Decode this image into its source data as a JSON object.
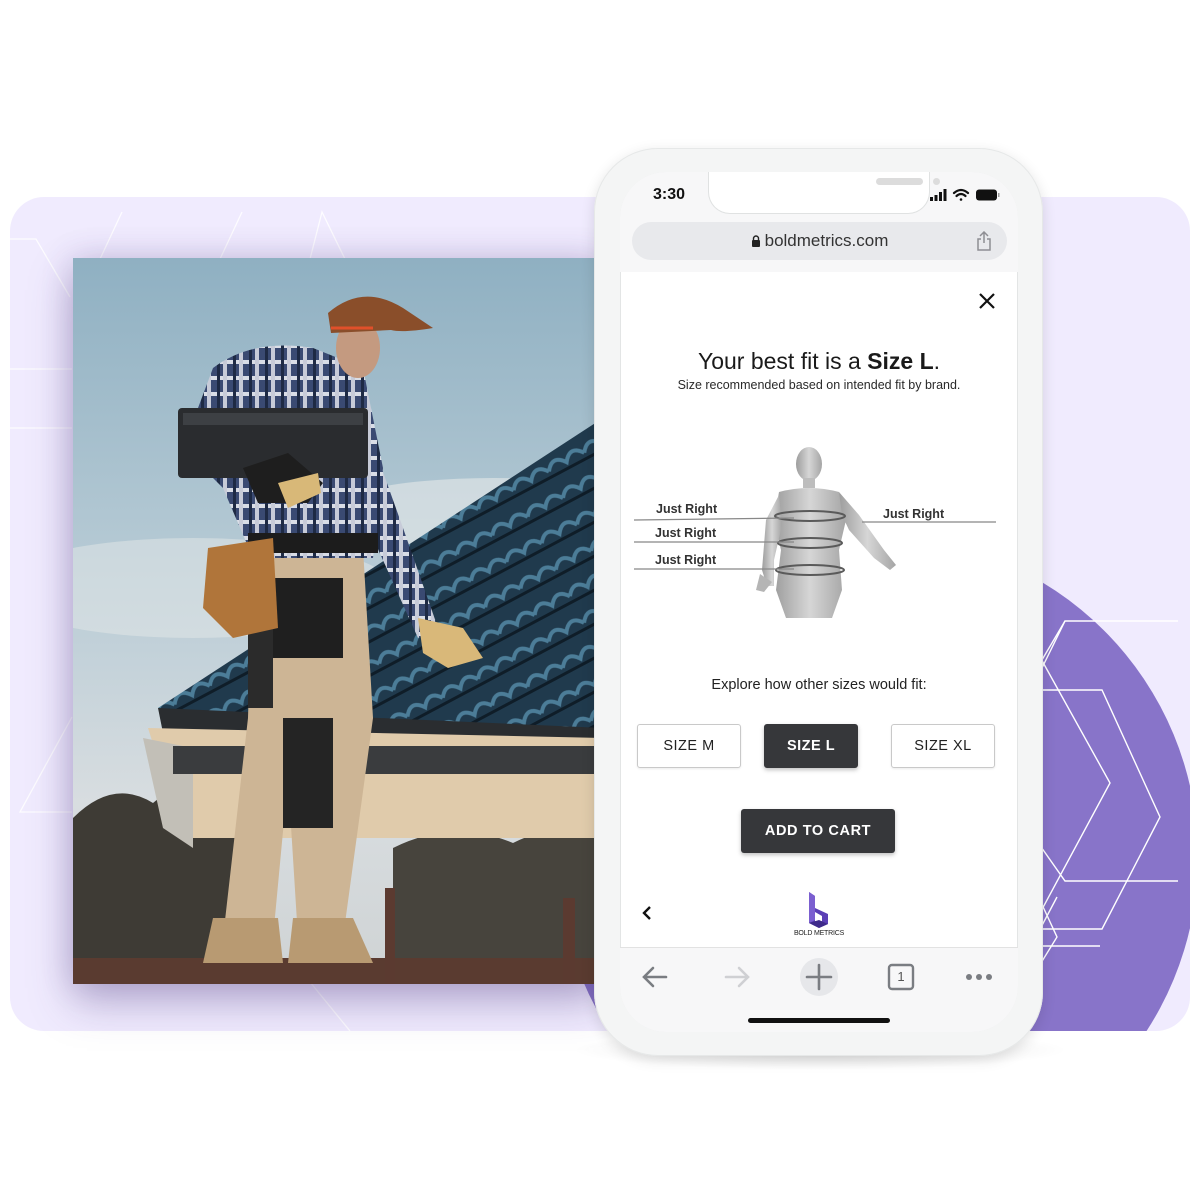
{
  "colors": {
    "panel_bg": "#f0ebfe",
    "circle": "#8874c9",
    "button_dark": "#36373a",
    "logo_purple": "#5b3fb6"
  },
  "photo": {
    "description": "Roofer in plaid shirt, cap and work overalls carrying roof tiles on a blue tiled roof"
  },
  "phone": {
    "status": {
      "time": "3:30",
      "icons": [
        "signal-icon",
        "wifi-icon",
        "battery-icon"
      ]
    },
    "url_bar": {
      "url": "boldmetrics.com",
      "icons": [
        "lock-icon",
        "share-icon"
      ]
    },
    "modal": {
      "close_icon": "close-icon",
      "headline_prefix": "Your best fit is a ",
      "headline_size": "Size L",
      "headline_suffix": ".",
      "subline": "Size recommended based on intended fit by brand.",
      "fit_labels": [
        {
          "area": "chest",
          "label": "Just Right"
        },
        {
          "area": "waist",
          "label": "Just Right"
        },
        {
          "area": "hip",
          "label": "Just Right"
        },
        {
          "area": "sleeve",
          "label": "Just Right"
        }
      ],
      "explore_text": "Explore how other sizes would fit:",
      "sizes": [
        {
          "label": "SIZE M",
          "selected": false
        },
        {
          "label": "SIZE L",
          "selected": true
        },
        {
          "label": "SIZE XL",
          "selected": false
        }
      ],
      "add_to_cart": "ADD TO CART",
      "back_icon": "chevron-left-icon",
      "logo_text": "BOLD METRICS"
    },
    "browser_toolbar": {
      "back": "arrow-left-icon",
      "forward": "arrow-right-icon",
      "new_tab": "plus-icon",
      "tab_count": "1",
      "more": "more-dots-icon"
    }
  }
}
